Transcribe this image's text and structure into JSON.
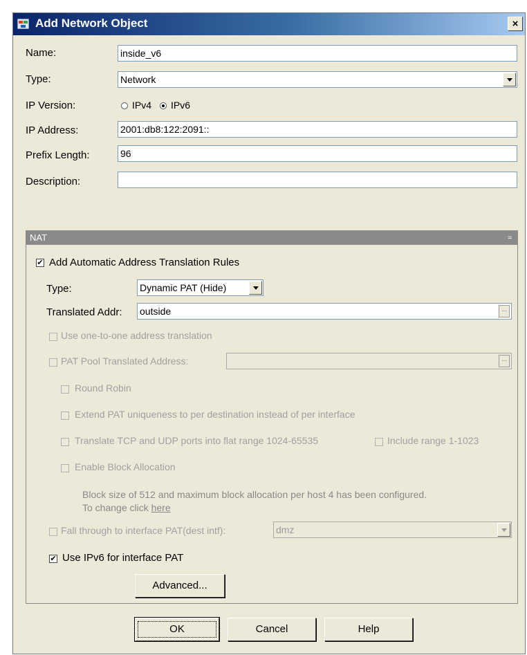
{
  "dialog": {
    "title": "Add Network Object",
    "close_label": "×"
  },
  "form": {
    "name_label": "Name:",
    "name_value": "inside_v6",
    "type_label": "Type:",
    "type_value": "Network",
    "ip_version_label": "IP Version:",
    "ipv4_label": "IPv4",
    "ipv6_label": "IPv6",
    "ip_version_selected": "IPv6",
    "ip_address_label": "IP Address:",
    "ip_address_value": "2001:db8:122:2091::",
    "prefix_length_label": "Prefix Length:",
    "prefix_length_value": "96",
    "description_label": "Description:",
    "description_value": ""
  },
  "nat": {
    "header": "NAT",
    "add_rules_label": "Add Automatic Address Translation Rules",
    "add_rules_checked": true,
    "type_label": "Type:",
    "type_value": "Dynamic PAT (Hide)",
    "translated_addr_label": "Translated Addr:",
    "translated_addr_value": "outside",
    "one_to_one_label": "Use one-to-one address translation",
    "pat_pool_label": "PAT Pool Translated Address:",
    "pat_pool_value": "",
    "round_robin_label": "Round Robin",
    "extend_pat_label": "Extend PAT uniqueness to per destination instead of per interface",
    "translate_ports_label": "Translate TCP and UDP ports into flat range 1024-65535",
    "include_range_label": "Include range 1-1023",
    "block_allocation_label": "Enable Block Allocation",
    "block_info_line1": "Block size of 512 and maximum block allocation per host 4 has been configured.",
    "block_info_line2": "To change click",
    "block_info_link": "here",
    "fall_through_label": "Fall through to interface PAT(dest intf):",
    "fall_through_value": "dmz",
    "use_ipv6_label": "Use IPv6 for interface PAT",
    "use_ipv6_checked": true,
    "advanced_button": "Advanced..."
  },
  "buttons": {
    "ok": "OK",
    "cancel": "Cancel",
    "help": "Help"
  },
  "colors": {
    "title_bar": "#0a246a",
    "dialog_bg": "#ece9d8",
    "nat_header": "#8a8a8a"
  }
}
